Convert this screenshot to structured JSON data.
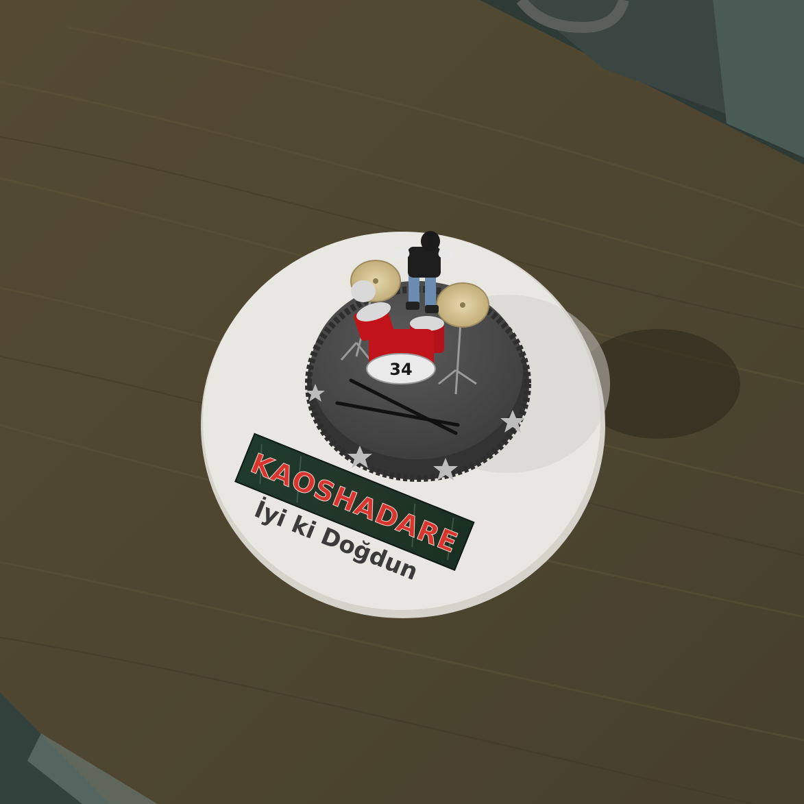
{
  "scene": {
    "banner_text": "KAOSHADARE",
    "cake_message": "İyi ki Doğdun",
    "drum_number": "34"
  },
  "colors": {
    "table_wood": "#4f4630",
    "table_wood_light": "#6a5c3e",
    "floor": "#2d3a36",
    "cake_board": "#e8e6df",
    "cake_fondant": "#4a4a4a",
    "drum_red": "#c0141a",
    "cymbal_gold": "#d8c79a",
    "banner_bg": "#1f2a22",
    "banner_text": "#d8352e",
    "message_text": "#3b3b3b"
  },
  "icons": [
    "drum-kit-icon",
    "drumsticks-icon",
    "drummer-figurine-icon",
    "star-decoration-icon"
  ]
}
